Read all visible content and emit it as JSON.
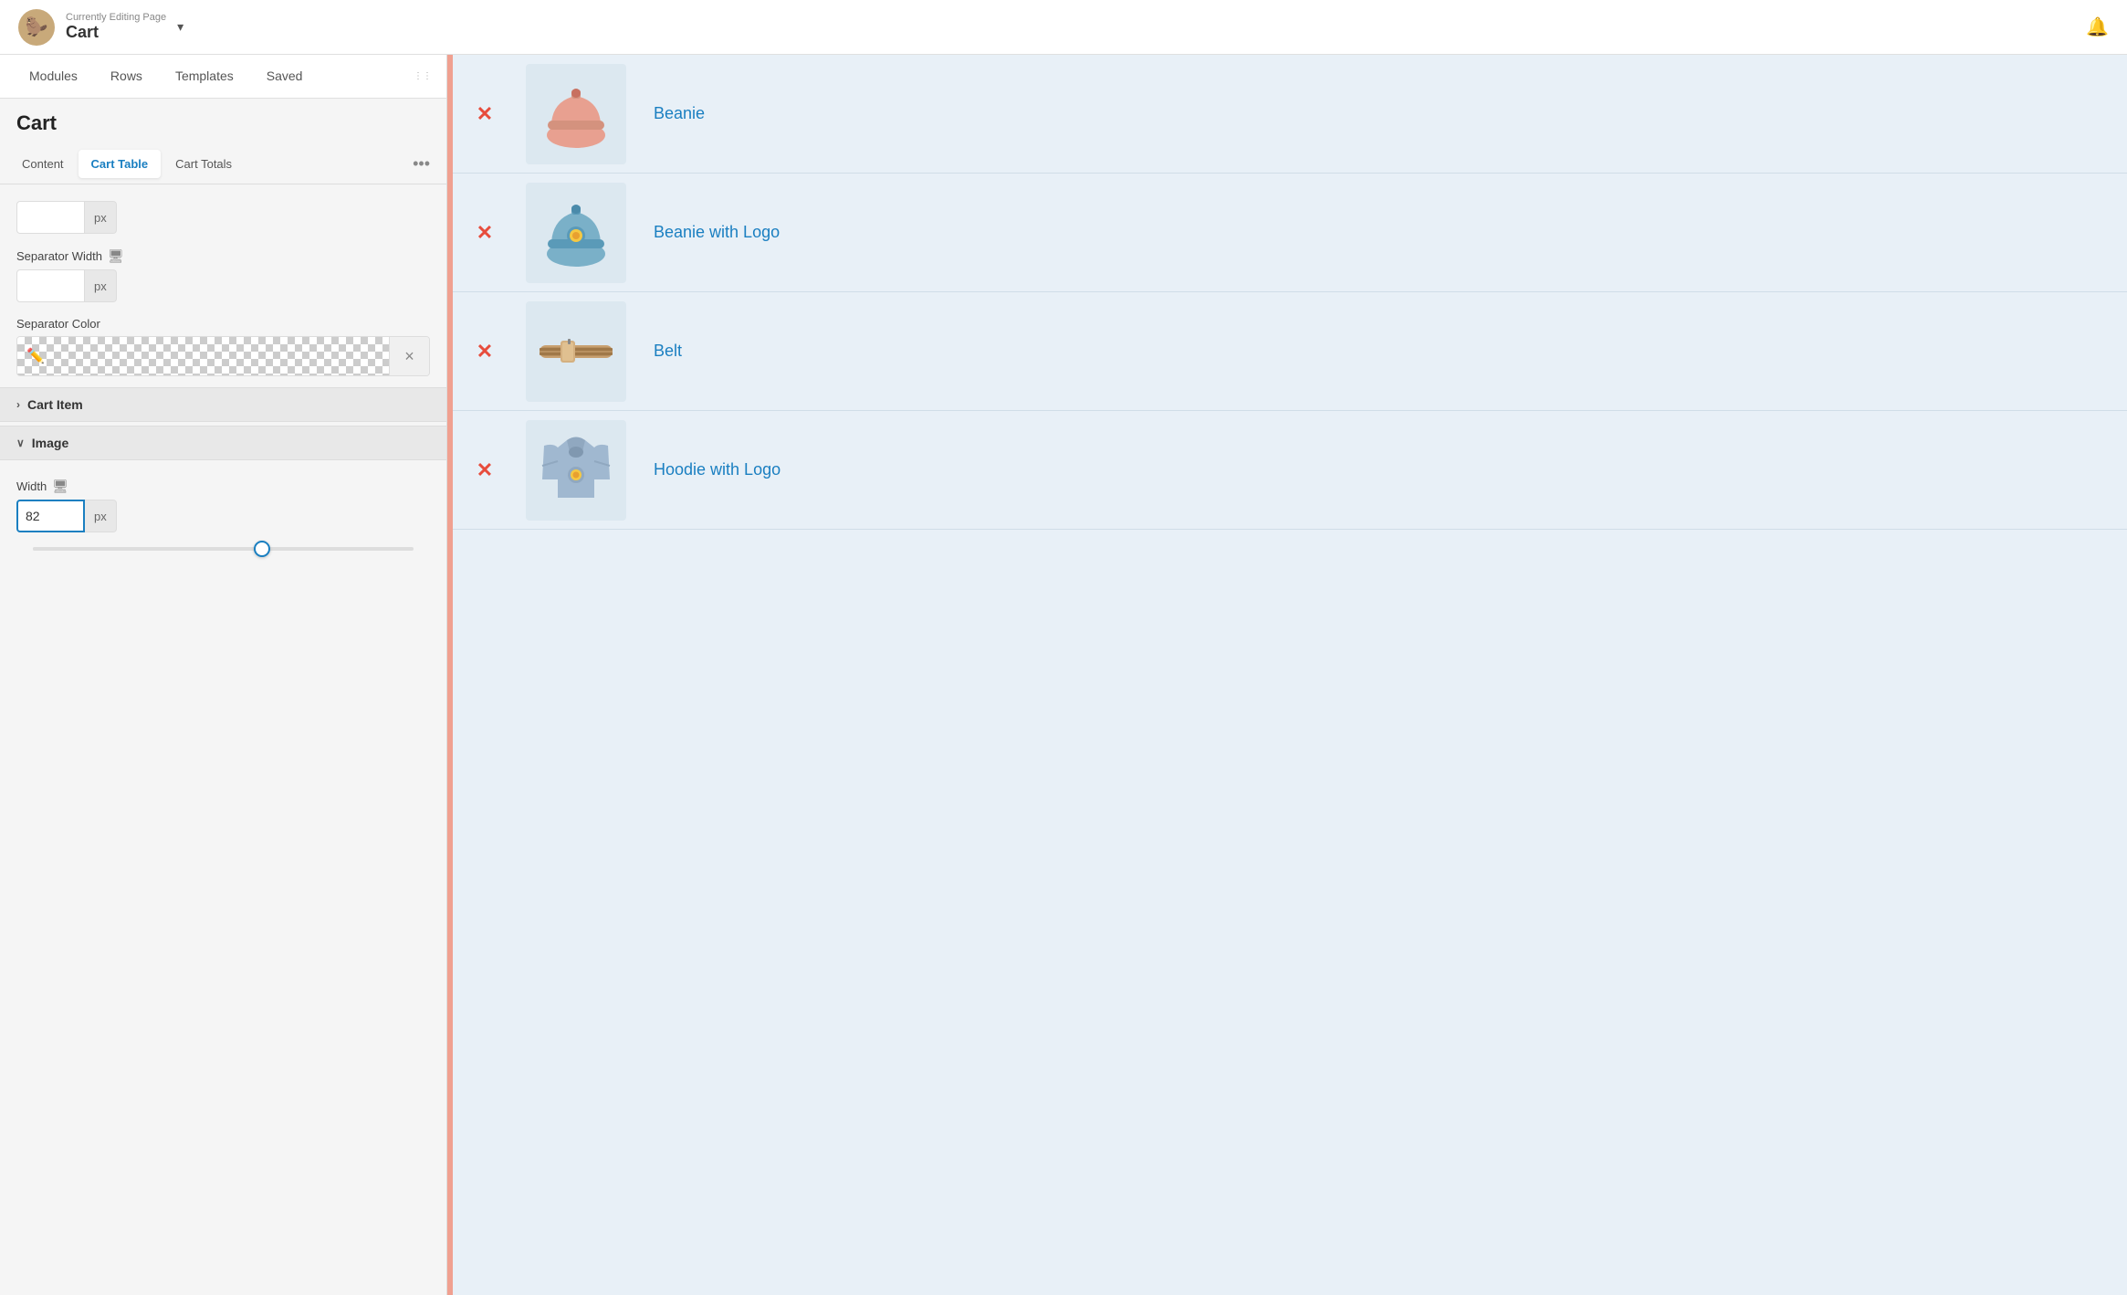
{
  "topbar": {
    "editing_label": "Currently Editing Page",
    "page_title": "Cart",
    "chevron": "▾",
    "bell": "🔔",
    "avatar_emoji": "🦫"
  },
  "left_panel": {
    "tabs": [
      {
        "id": "modules",
        "label": "Modules",
        "active": false
      },
      {
        "id": "rows",
        "label": "Rows",
        "active": false
      },
      {
        "id": "templates",
        "label": "Templates",
        "active": false
      },
      {
        "id": "saved",
        "label": "Saved",
        "active": false
      }
    ],
    "title": "Cart",
    "sub_tabs": [
      {
        "id": "content",
        "label": "Content",
        "active": false
      },
      {
        "id": "cart-table",
        "label": "Cart Table",
        "active": true
      },
      {
        "id": "cart-totals",
        "label": "Cart Totals",
        "active": false
      }
    ],
    "more_label": "•••",
    "separator_width_label": "Separator Width",
    "unit": "px",
    "separator_color_label": "Separator Color",
    "eyedropper": "✏",
    "clear": "×",
    "sections": [
      {
        "id": "cart-item",
        "label": "Cart Item",
        "collapsed": true
      },
      {
        "id": "image",
        "label": "Image",
        "collapsed": false
      }
    ],
    "width_label": "Width",
    "width_value": "82",
    "monitor_icon": "🖥"
  },
  "cart_items": [
    {
      "id": 1,
      "name": "Beanie",
      "type": "beanie",
      "emoji": "🧢"
    },
    {
      "id": 2,
      "name": "Beanie with Logo",
      "type": "beanie-logo",
      "emoji": "🧢"
    },
    {
      "id": 3,
      "name": "Belt",
      "type": "belt",
      "emoji": "👔"
    },
    {
      "id": 4,
      "name": "Hoodie with Logo",
      "type": "hoodie",
      "emoji": "🧥"
    }
  ],
  "colors": {
    "accent_blue": "#1a7fc1",
    "remove_red": "#e74c3c",
    "cart_bg": "#e8f0f7",
    "separator_pink": "#f0a090"
  }
}
